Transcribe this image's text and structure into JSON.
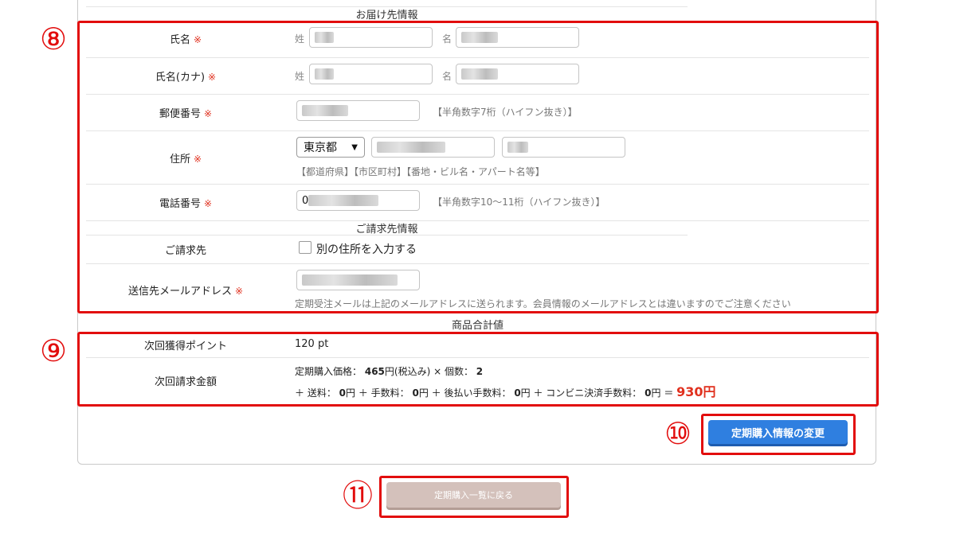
{
  "sections": {
    "delivery_title": "お届け先情報",
    "billing_title": "ご請求先情報",
    "summary_title": "商品合計値"
  },
  "required_mark": "※",
  "fields": {
    "name_label": "氏名",
    "kana_label": "氏名(カナ)",
    "last_label": "姓",
    "first_label": "名",
    "postal_label": "郵便番号",
    "postal_value": "",
    "postal_hint": "【半角数字7桁（ハイフン抜き）】",
    "address_label": "住所",
    "prefecture_value": "東京都",
    "address_hint": "【都道府県】【市区町村】【番地・ビル名・アパート名等】",
    "phone_label": "電話番号",
    "phone_value": "0",
    "phone_hint": "【半角数字10〜11桁（ハイフン抜き）】",
    "billing_label": "ご請求先",
    "billing_checkbox_label": "別の住所を入力する",
    "email_label": "送信先メールアドレス",
    "email_note": "定期受注メールは上記のメールアドレスに送られます。会員情報のメールアドレスとは違いますのでご注意ください"
  },
  "summary": {
    "points_label": "次回獲得ポイント",
    "points_value": "120 pt",
    "amount_label": "次回請求金額",
    "line1_prefix": "定期購入価格：",
    "unit_price": "465",
    "line1_mid": "円(税込み) × 個数：",
    "quantity": "2",
    "shipping_label": "＋ 送料：",
    "shipping_value": "0",
    "fee_label": "円 ＋ 手数料：",
    "fee_value": "0",
    "deferred_label": "円 ＋ 後払い手数料：",
    "deferred_value": "0",
    "conv_label": "円 ＋ コンビニ決済手数料：",
    "conv_value": "0",
    "equals": "円 ＝",
    "total": "930円"
  },
  "buttons": {
    "change": "定期購入情報の変更",
    "back": "定期購入一覧に戻る"
  },
  "annotations": {
    "n8": "⑧",
    "n9": "⑨",
    "n10": "⑩",
    "n11": "⑪"
  },
  "colors": {
    "annotation_red": "#e20d0d",
    "required_red": "#e0301e",
    "primary_button": "#2f7fe0",
    "secondary_button": "#d4c1bb"
  }
}
